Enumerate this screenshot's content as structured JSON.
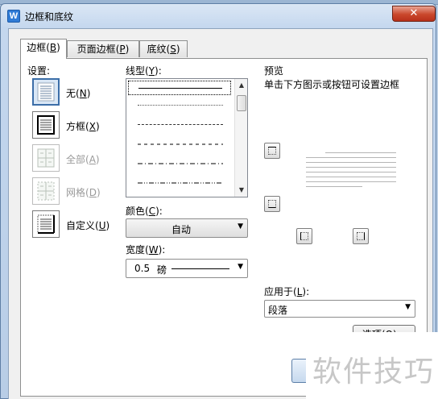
{
  "window": {
    "title": "边框和底纹",
    "close_label": "✕"
  },
  "tabs": [
    {
      "label": "边框",
      "key": "B"
    },
    {
      "label": "页面边框",
      "key": "P"
    },
    {
      "label": "底纹",
      "key": "S"
    }
  ],
  "settings": {
    "heading": "设置:",
    "items": [
      {
        "label": "无",
        "key": "N",
        "icon": "border-none-icon",
        "selected": true,
        "disabled": false
      },
      {
        "label": "方框",
        "key": "X",
        "icon": "border-box-icon",
        "selected": false,
        "disabled": false
      },
      {
        "label": "全部",
        "key": "A",
        "icon": "border-all-icon",
        "selected": false,
        "disabled": true
      },
      {
        "label": "网格",
        "key": "D",
        "icon": "border-grid-icon",
        "selected": false,
        "disabled": true
      },
      {
        "label": "自定义",
        "key": "U",
        "icon": "border-custom-icon",
        "selected": false,
        "disabled": false
      }
    ]
  },
  "line_style": {
    "heading": "线型",
    "key": "Y",
    "items": [
      "solid",
      "dotted",
      "dashed-small",
      "dashed",
      "dash-dot",
      "dash-dot-dot",
      "long-dash"
    ]
  },
  "color": {
    "heading": "颜色",
    "key": "C",
    "value": "自动"
  },
  "width": {
    "heading": "宽度",
    "key": "W",
    "value": "0.5",
    "unit": "磅"
  },
  "preview": {
    "heading": "预览",
    "hint": "单击下方图示或按钮可设置边框"
  },
  "apply_to": {
    "heading": "应用于",
    "key": "L",
    "value": "段落"
  },
  "options_button": {
    "label": "选项(O)..."
  },
  "watermark": {
    "text": "软件技巧"
  },
  "colors": {
    "accent": "#3c6ea8",
    "close": "#c9472c"
  }
}
